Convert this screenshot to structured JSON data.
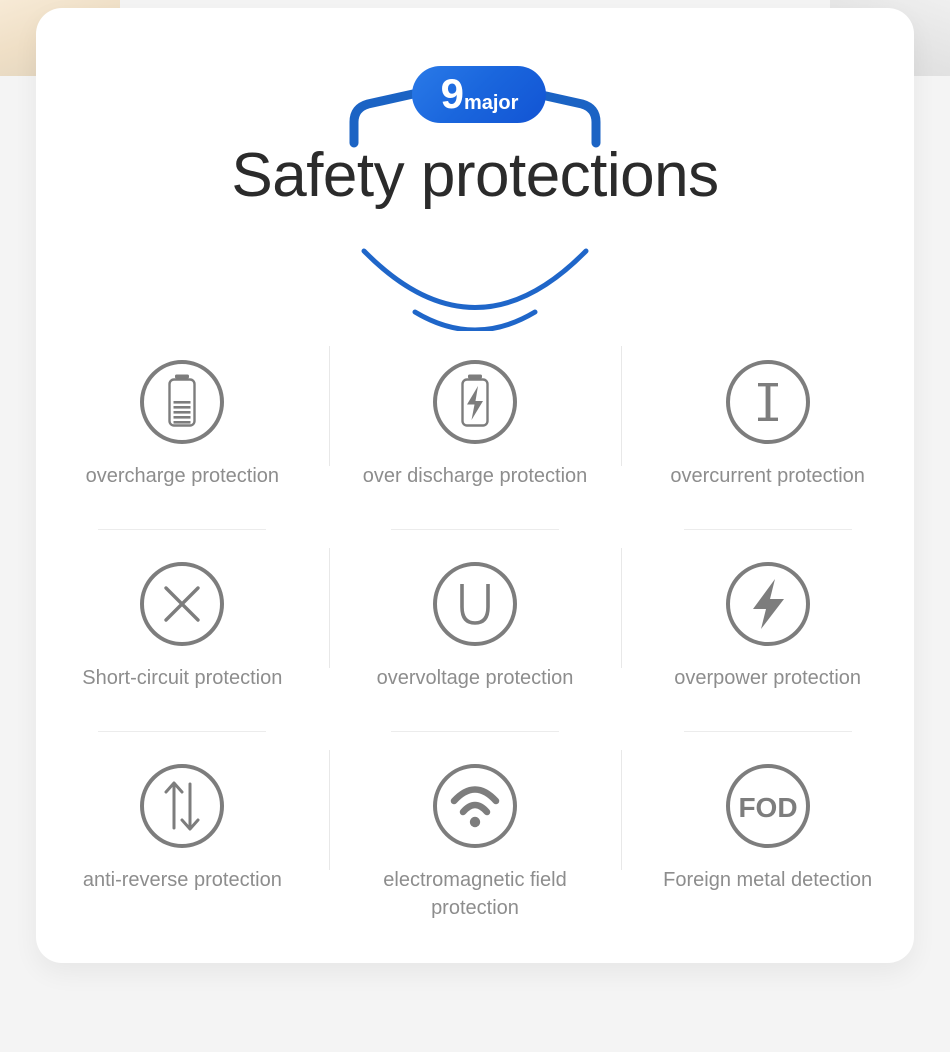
{
  "badge": {
    "number": "9",
    "word": "major"
  },
  "title": "Safety protections",
  "colors": {
    "badge_blue": "#1a66dd",
    "bracket_blue": "#1b63c4",
    "swoosh_blue": "#1f66c9",
    "title_text": "#2b2b2b",
    "label_text": "#8d8d8d",
    "divider": "#ececec",
    "card_bg": "#ffffff",
    "page_bg": "#f4f4f4"
  },
  "items": [
    {
      "icon": "battery-charge-level-icon",
      "label": "overcharge protection"
    },
    {
      "icon": "battery-bolt-icon",
      "label": "over discharge protection"
    },
    {
      "icon": "current-letter-i-icon",
      "label": "overcurrent protection"
    },
    {
      "icon": "x-cross-icon",
      "label": "Short-circuit protection"
    },
    {
      "icon": "voltage-letter-u-icon",
      "label": "overvoltage protection"
    },
    {
      "icon": "lightning-bolt-icon",
      "label": "overpower protection"
    },
    {
      "icon": "up-down-arrows-icon",
      "label": "anti-reverse protection"
    },
    {
      "icon": "wifi-signal-waves-icon",
      "label": "electromagnetic field protection"
    },
    {
      "icon": "fod-text-icon",
      "label": "Foreign metal detection"
    }
  ]
}
